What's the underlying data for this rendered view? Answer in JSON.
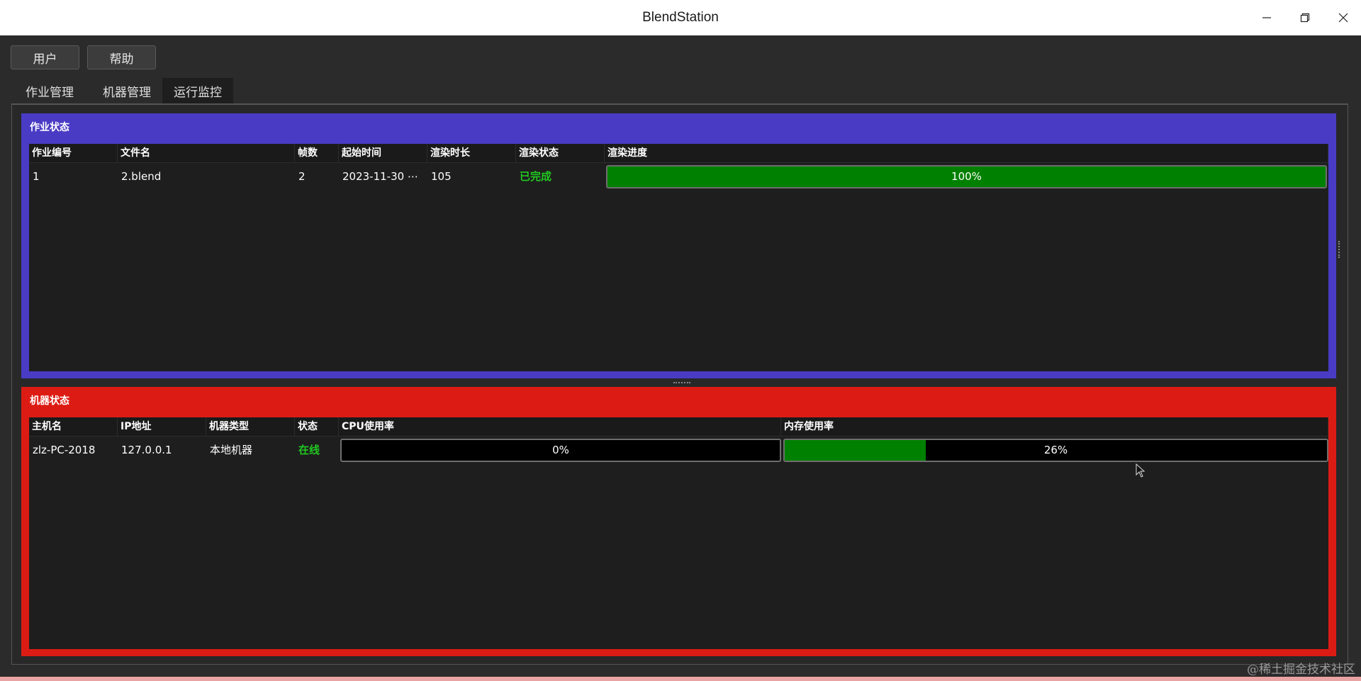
{
  "window": {
    "title": "BlendStation"
  },
  "menu": {
    "user": "用户",
    "help": "帮助"
  },
  "tabs": [
    "作业管理",
    "机器管理",
    "运行监控"
  ],
  "active_tab": "运行监控",
  "jobs": {
    "title": "作业状态",
    "columns": [
      "作业编号",
      "文件名",
      "帧数",
      "起始时间",
      "渲染时长",
      "渲染状态",
      "渲染进度"
    ],
    "rows": [
      {
        "id": "1",
        "file": "2.blend",
        "frames": "2",
        "start": "2023-11-30 ⋯",
        "duration": "105",
        "status": "已完成",
        "progress": 100,
        "progress_label": "100%"
      }
    ]
  },
  "machines": {
    "title": "机器状态",
    "columns": [
      "主机名",
      "IP地址",
      "机器类型",
      "状态",
      "CPU使用率",
      "内存使用率"
    ],
    "rows": [
      {
        "host": "zlz-PC-2018",
        "ip": "127.0.0.1",
        "type": "本地机器",
        "state": "在线",
        "cpu": 0,
        "cpu_label": "0%",
        "mem": 26,
        "mem_label": "26%"
      }
    ]
  },
  "watermark": "@稀土掘金技术社区",
  "colors": {
    "jobs_panel": "#4a3bc4",
    "machines_panel": "#dc1c14",
    "progress_fill": "#008000",
    "status_green": "#21c821"
  },
  "icons": [
    "minimize-icon",
    "restore-icon",
    "close-icon",
    "mouse-cursor-icon"
  ]
}
